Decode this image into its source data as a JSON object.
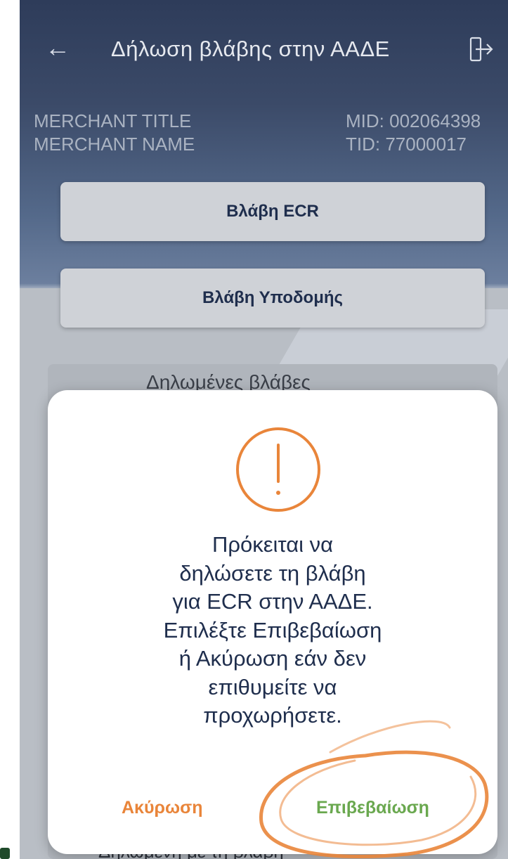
{
  "header": {
    "title": "Δήλωση βλάβης στην ΑΑΔΕ",
    "back_icon": "arrow-left-icon",
    "exit_icon": "logout-icon"
  },
  "merchant": {
    "title": "MERCHANT TITLE",
    "name": "MERCHANT NAME",
    "mid": "MID: 002064398",
    "tid": "TID: 77000017"
  },
  "actions": {
    "ecr_label": "Βλάβη ECR",
    "infra_label": "Βλάβη Υποδομής"
  },
  "background": {
    "card_title": "Δηλωμένες βλάβες",
    "bottom_text": "Δηλωμένη με τη βλάβη"
  },
  "dialog": {
    "icon": "warning-icon",
    "message_lines": [
      "Πρόκειται να",
      "δηλώσετε τη βλάβη",
      "για ECR στην ΑΑΔΕ.",
      "Επιλέξτε Επιβεβαίωση",
      "ή Ακύρωση εάν δεν",
      "επιθυμείτε να",
      "προχωρήσετε."
    ],
    "cancel_label": "Ακύρωση",
    "confirm_label": "Επιβεβαίωση"
  },
  "colors": {
    "header_bg": "#2e3c5a",
    "accent_orange": "#e9853a",
    "confirm_green": "#6aa84f",
    "text_dark": "#1f2e4d"
  }
}
